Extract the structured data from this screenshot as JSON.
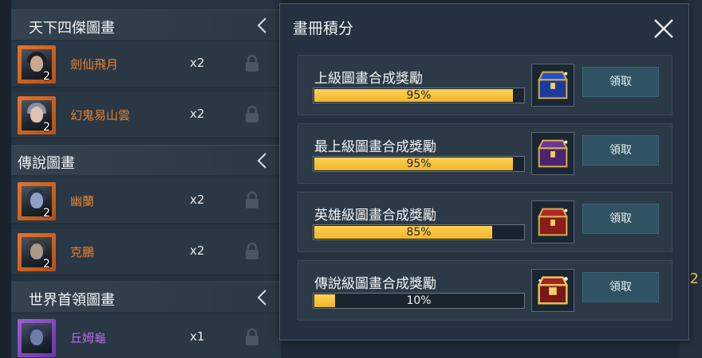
{
  "left_list": {
    "sections": [
      {
        "title": "天下四傑圖畫",
        "cards": [
          {
            "name": "劍仙飛月",
            "count": "2",
            "qty": "x2",
            "rarity": "orange"
          },
          {
            "name": "幻鬼易山雲",
            "count": "2",
            "qty": "x2",
            "rarity": "orange"
          }
        ]
      },
      {
        "title": "傳說圖畫",
        "cards": [
          {
            "name": "幽蘭",
            "count": "2",
            "qty": "x2",
            "rarity": "orange"
          },
          {
            "name": "克鵬",
            "count": "2",
            "qty": "x2",
            "rarity": "orange"
          }
        ]
      },
      {
        "title": "世界首領圖畫",
        "cards": [
          {
            "name": "丘姆龜",
            "count": "",
            "qty": "x1",
            "rarity": "purple"
          }
        ]
      }
    ]
  },
  "background": {
    "right_edge_number": "2"
  },
  "popup": {
    "title": "畫冊積分",
    "rewards": [
      {
        "label": "上級圖畫合成獎勵",
        "progress": 0.95,
        "progress_text": "95%",
        "button": "領取",
        "icon": "blue-treasure-chest-icon"
      },
      {
        "label": "最上級圖畫合成獎勵",
        "progress": 0.95,
        "progress_text": "95%",
        "button": "領取",
        "icon": "purple-treasure-chest-icon"
      },
      {
        "label": "英雄級圖畫合成獎勵",
        "progress": 0.85,
        "progress_text": "85%",
        "button": "領取",
        "icon": "red-treasure-chest-icon"
      },
      {
        "label": "傳說級圖畫合成獎勵",
        "progress": 0.1,
        "progress_text": "10%",
        "button": "領取",
        "icon": "golden-red-treasure-chest-icon"
      }
    ]
  },
  "colors": {
    "rarity_orange": "#e8832e",
    "rarity_purple": "#b66ce8",
    "progress_fill": "#f2b629"
  }
}
